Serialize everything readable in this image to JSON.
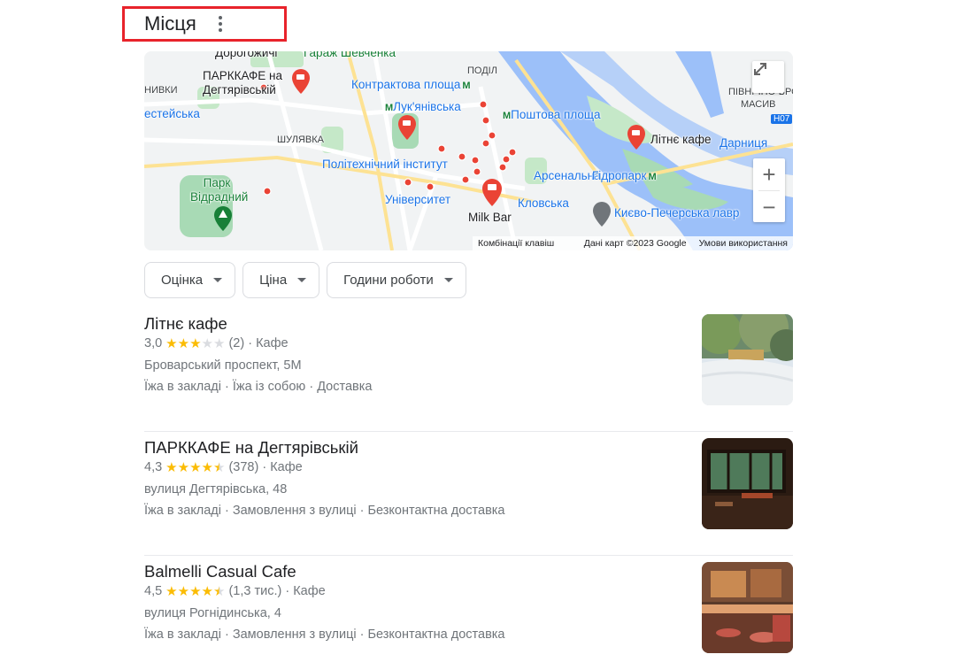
{
  "header": {
    "title": "Місця"
  },
  "map": {
    "labels": {
      "dorohozhychi": "Дорогожичі",
      "shevchenka": "Гараж Шевченка",
      "parkcafe": "ПАРККАФЕ на Дегтярівській",
      "kontraktova": "Контрактова площа",
      "podil": "ПОДІЛ",
      "lukianivska": "Лук'янівська",
      "poshtova": "Поштова площа",
      "litne": "Літнє кафе",
      "darnytsia": "Дарниця",
      "shuliavka": "ШУЛЯВКА",
      "polytech": "Політехнічний інститут",
      "arsenalna": "Арсенальна",
      "hydropark": "Гідропарк",
      "park_vidradnyi": "Парк Відрадний",
      "universytet": "Університет",
      "klovska": "Кловська",
      "milkbar": "Milk Bar",
      "lavra": "Києво-Печерська лавр",
      "nyvky": "НИВКИ",
      "berestejska": "естейська",
      "pivnichno": "ПІВНІЧНО-БРОВ",
      "masyv": "МАСИВ",
      "road": "Н07"
    },
    "attribution": {
      "shortcuts": "Комбінації клавіш",
      "data": "Дані карт ©2023 Google",
      "terms": "Умови використання"
    },
    "zoom_in": "+",
    "zoom_out": "−"
  },
  "filters": [
    {
      "label": "Оцінка"
    },
    {
      "label": "Ціна"
    },
    {
      "label": "Години роботи"
    }
  ],
  "results": [
    {
      "name": "Літнє кафе",
      "rating": "3,0",
      "rating_value": 3.0,
      "reviews": "(2)",
      "category": "Кафе",
      "address": "Броварський проспект, 5М",
      "options": "Їжа в закладі · Їжа із собою · Доставка"
    },
    {
      "name": "ПАРККАФЕ на Дегтярівській",
      "rating": "4,3",
      "rating_value": 4.3,
      "reviews": "(378)",
      "category": "Кафе",
      "address": "вулиця Дегтярівська, 48",
      "options": "Їжа в закладі · Замовлення з вулиці · Безконтактна доставка"
    },
    {
      "name": "Balmelli Casual Cafe",
      "rating": "4,5",
      "rating_value": 4.5,
      "reviews": "(1,3 тис.)",
      "category": "Кафе",
      "address": "вулиця Рогнідинська, 4",
      "options": "Їжа в закладі · Замовлення з вулиці · Безконтактна доставка"
    }
  ],
  "colors": {
    "accent_red": "#e8232b",
    "star": "#fbbc04",
    "water": "#9cc0f9",
    "park": "#a8dab5",
    "metro": "#188038",
    "label_blue": "#1a73e8"
  }
}
